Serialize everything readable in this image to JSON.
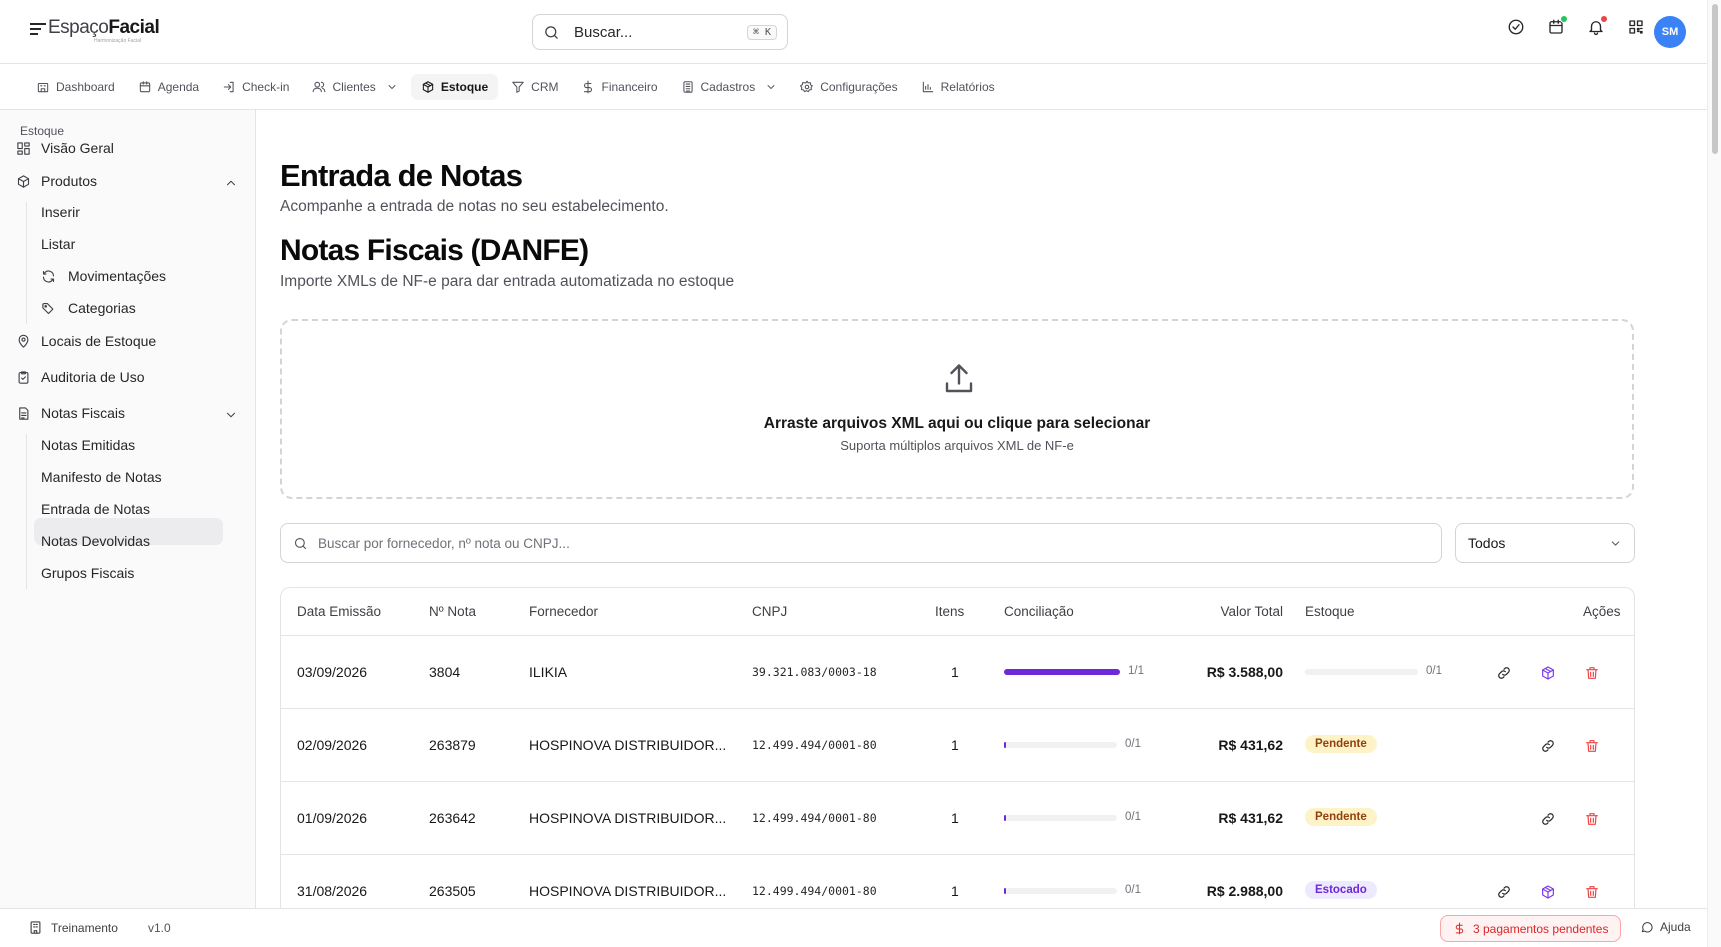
{
  "header": {
    "logo_prefix": "Espaço",
    "logo_bold": "Facial",
    "logo_sub": "Harmonização Facial",
    "search_label": "Buscar...",
    "search_shortcut": "⌘ K",
    "avatar_initials": "SM",
    "icons": [
      "check-circle-icon",
      "calendar-badge-icon",
      "bell-icon",
      "qr-code-icon"
    ],
    "dot_green": "#22c55e",
    "dot_red": "#ef4444"
  },
  "nav": [
    {
      "label": "Dashboard",
      "icon": "building-icon"
    },
    {
      "label": "Agenda",
      "icon": "calendar-icon"
    },
    {
      "label": "Check-in",
      "icon": "login-icon"
    },
    {
      "label": "Clientes",
      "icon": "users-icon"
    },
    {
      "label": "Estoque",
      "icon": "package-icon"
    },
    {
      "label": "CRM",
      "icon": "filter-icon"
    },
    {
      "label": "Financeiro",
      "icon": "dollar-icon"
    },
    {
      "label": "Cadastros",
      "icon": "clipboard-icon"
    },
    {
      "label": "Configurações",
      "icon": "gear-icon"
    },
    {
      "label": "Relatórios",
      "icon": "chart-icon"
    }
  ],
  "sidebar": {
    "title": "Estoque",
    "visao_geral": "Visão Geral",
    "produtos": "Produtos",
    "produtos_sub": [
      "Inserir",
      "Listar",
      "Movimentações",
      "Categorias"
    ],
    "locais": "Locais de Estoque",
    "auditoria": "Auditoria de Uso",
    "notas": "Notas Fiscais",
    "notas_sub": [
      "Notas Emitidas",
      "Manifesto de Notas",
      "Entrada de Notas",
      "Notas Devolvidas",
      "Grupos Fiscais"
    ]
  },
  "main": {
    "title": "Entrada de Notas",
    "subtitle": "Acompanhe a entrada de notas no seu estabelecimento.",
    "section_title": "Notas Fiscais (DANFE)",
    "section_subtitle": "Importe XMLs de NF-e para dar entrada automatizada no estoque",
    "drop_title": "Arraste arquivos XML aqui ou clique para selecionar",
    "drop_subtitle": "Suporta múltiplos arquivos XML de NF-e",
    "search_placeholder": "Buscar por fornecedor, nº nota ou CNPJ...",
    "filter_value": "Todos"
  },
  "table": {
    "headers": [
      "Data Emissão",
      "Nº Nota",
      "Fornecedor",
      "CNPJ",
      "Itens",
      "Conciliação",
      "Valor Total",
      "Estoque",
      "Ações"
    ],
    "rows": [
      {
        "data": "03/09/2026",
        "nota": "3804",
        "fornecedor": "ILIKIA",
        "cnpj": "39.321.083/0003-18",
        "itens": "1",
        "conc_label": "1/1",
        "conc_frac": 1.0,
        "valor": "R$ 3.588,00",
        "estoque_type": "bar",
        "estoque_label": "0/1",
        "estoque_frac": 0.0,
        "stock_action": true
      },
      {
        "data": "02/09/2026",
        "nota": "263879",
        "fornecedor": "HOSPINOVA DISTRIBUIDOR...",
        "cnpj": "12.499.494/0001-80",
        "itens": "1",
        "conc_label": "0/1",
        "conc_frac": 0.0,
        "valor": "R$ 431,62",
        "estoque_type": "badge",
        "estoque_label": "Pendente",
        "stock_action": false
      },
      {
        "data": "01/09/2026",
        "nota": "263642",
        "fornecedor": "HOSPINOVA DISTRIBUIDOR...",
        "cnpj": "12.499.494/0001-80",
        "itens": "1",
        "conc_label": "0/1",
        "conc_frac": 0.0,
        "valor": "R$ 431,62",
        "estoque_type": "badge",
        "estoque_label": "Pendente",
        "stock_action": false
      },
      {
        "data": "31/08/2026",
        "nota": "263505",
        "fornecedor": "HOSPINOVA DISTRIBUIDOR...",
        "cnpj": "12.499.494/0001-80",
        "itens": "1",
        "conc_label": "0/1",
        "conc_frac": 0.0,
        "valor": "R$ 2.988,00",
        "estoque_type": "badge",
        "estoque_label": "Estocado",
        "stock_action": true
      }
    ],
    "colors": {
      "conc_bar": "#6d28d9",
      "pendente_bg": "#fef3c7",
      "pendente_fg": "#92400e",
      "estocado_bg": "#ede9fe",
      "estocado_fg": "#6d28d9",
      "delete": "#ef4444",
      "stock_icon": "#7c3aed"
    }
  },
  "footer": {
    "env_label": "Treinamento",
    "version": "v1.0",
    "pending_label": "3 pagamentos pendentes",
    "help_label": "Ajuda"
  }
}
